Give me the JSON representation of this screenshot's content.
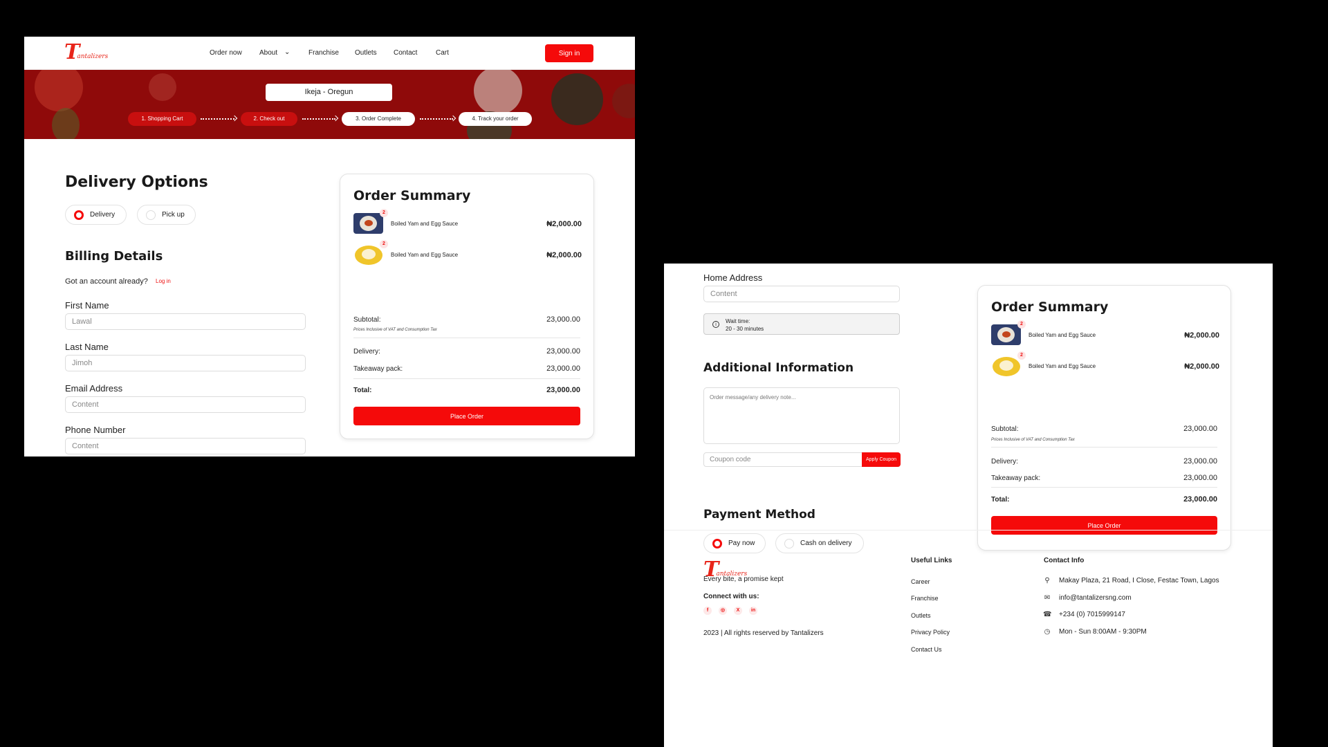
{
  "brand": {
    "logo_letter": "T",
    "logo_word": "antalizers"
  },
  "nav": {
    "links": [
      "Order now",
      "About",
      "Franchise",
      "Outlets",
      "Contact",
      "Cart"
    ],
    "signin": "Sign in"
  },
  "hero": {
    "location": "Ikeja - Oregun",
    "steps": [
      "1. Shopping Cart",
      "2. Check out",
      "3. Order Complete",
      "4. Track your order"
    ]
  },
  "delivery": {
    "title": "Delivery Options",
    "options": [
      "Delivery",
      "Pick up"
    ],
    "selected": "Delivery"
  },
  "billing": {
    "title": "Billing Details",
    "account_prompt": "Got an account already?",
    "login": "Log in",
    "fields": [
      {
        "label": "First Name",
        "value": "Lawal"
      },
      {
        "label": "Last Name",
        "value": "Jimoh"
      },
      {
        "label": "Email Address",
        "value": "Content"
      },
      {
        "label": "Phone Number",
        "value": "Content"
      }
    ],
    "home_address": {
      "label": "Home Address",
      "value": "Content"
    }
  },
  "wait": {
    "label": "Wait time:",
    "value": "20 - 30 minutes"
  },
  "additional": {
    "title": "Additional Information",
    "placeholder": "Order message/any delivery note...",
    "coupon_placeholder": "Coupon code",
    "coupon_button": "Apply Coupon"
  },
  "payment": {
    "title": "Payment Method",
    "options": [
      "Pay now",
      "Cash on delivery"
    ],
    "selected": "Pay now"
  },
  "summary": {
    "title": "Order Summary",
    "items": [
      {
        "name": "Boiled Yam and Egg Sauce",
        "qty": "2",
        "price": "₦2,000.00"
      },
      {
        "name": "Boiled Yam and Egg Sauce",
        "qty": "2",
        "price": "₦2,000.00"
      }
    ],
    "subtotal_label": "Subtotal:",
    "subtotal": "23,000.00",
    "tax_note": "Prices Inclusive of VAT and Consumption Tax",
    "delivery_label": "Delivery:",
    "delivery": "23,000.00",
    "takeaway_label": "Takeaway pack:",
    "takeaway": "23,000.00",
    "total_label": "Total:",
    "total": "23,000.00",
    "button": "Place Order"
  },
  "footer": {
    "tagline": "Every bite, a promise kept",
    "connect": "Connect with us:",
    "social": [
      "f",
      "◎",
      "X",
      "in"
    ],
    "copyright": "2023 | All rights reserved by Tantalizers",
    "links_title": "Useful Links",
    "links": [
      "Career",
      "Franchise",
      "Outlets",
      "Privacy Policy",
      "Contact Us"
    ],
    "contact_title": "Contact Info",
    "contact": [
      {
        "icon": "location-pin-icon",
        "text": "Makay Plaza, 21 Road, I Close, Festac Town, Lagos"
      },
      {
        "icon": "mail-icon",
        "text": "info@tantalizersng.com"
      },
      {
        "icon": "phone-icon",
        "text": "+234 (0) 7015999147"
      },
      {
        "icon": "clock-icon",
        "text": "Mon - Sun 8:00AM - 9:30PM"
      }
    ]
  },
  "colors": {
    "accent": "#f50a0a",
    "hero": "#8f0a0a",
    "step_active": "#c80f0f"
  }
}
